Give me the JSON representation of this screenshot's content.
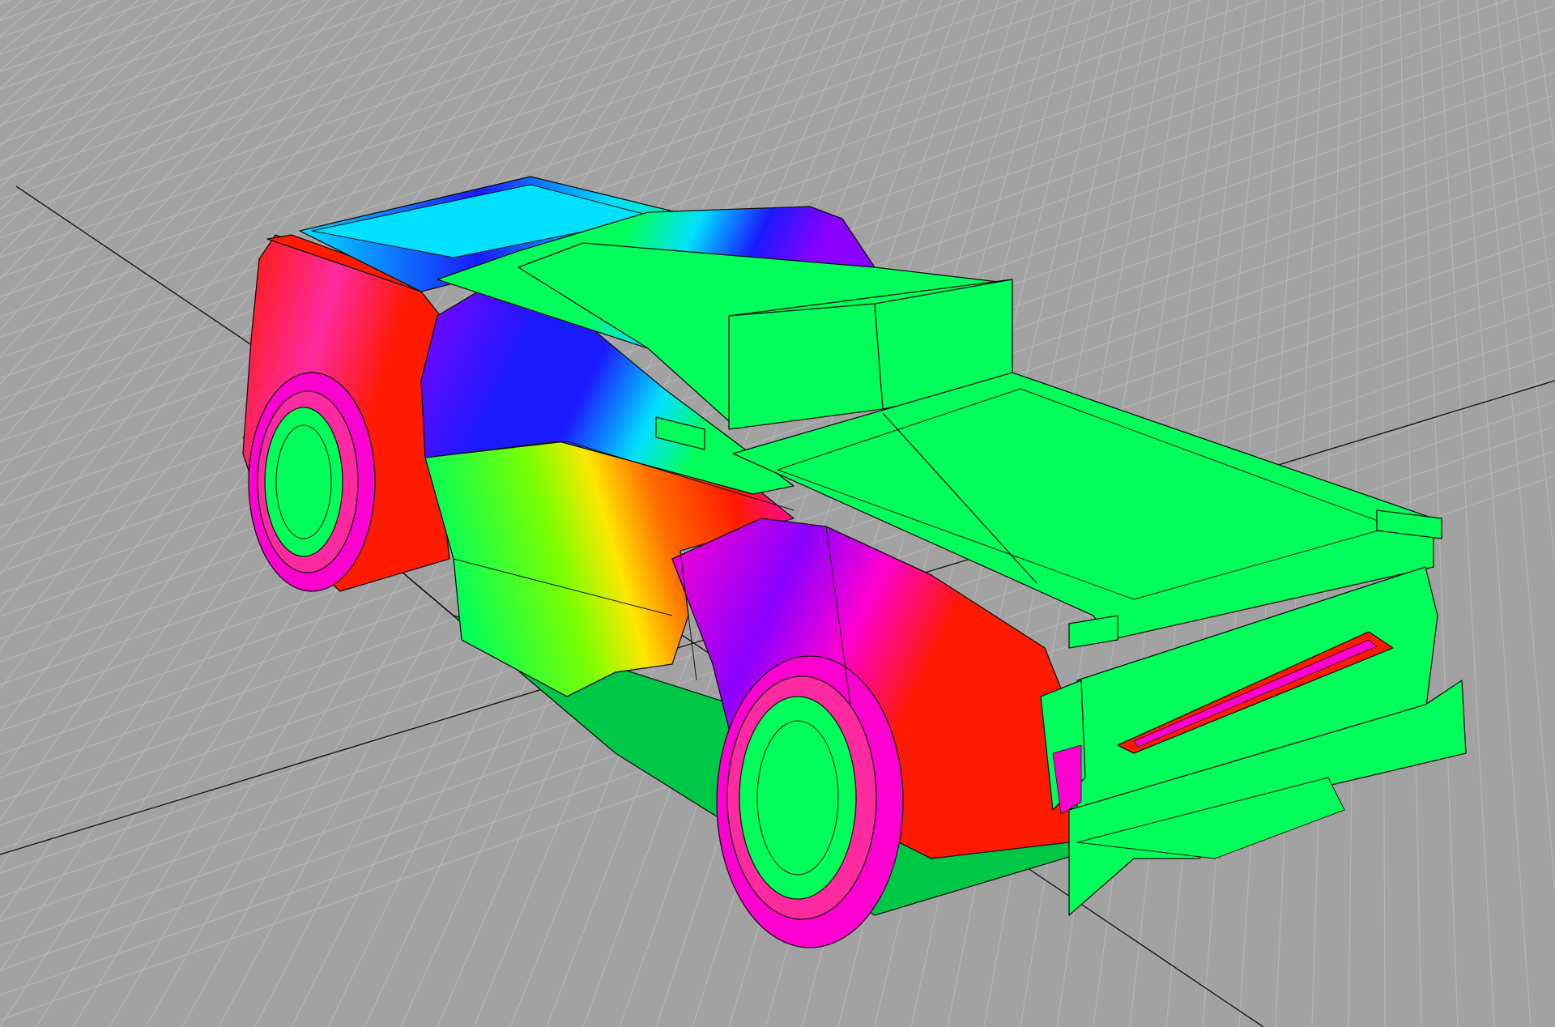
{
  "viewport": {
    "background_color": "#a2a2a2",
    "grid_color": "#b4b4b4",
    "axis_line_color": "#1a1a1a",
    "edge_line_color": "#111111"
  },
  "model": {
    "subject": "pickup-truck",
    "shading": "curvature-analysis",
    "palette": {
      "green": "#00ff5a",
      "red": "#ff1a00",
      "orange": "#ff6a00",
      "yellow": "#ffe600",
      "lime": "#7dff00",
      "cyan": "#00e0ff",
      "blue": "#1a1aff",
      "violet": "#8a00ff",
      "magenta": "#ff00d0",
      "pink": "#ff2aa0"
    }
  }
}
